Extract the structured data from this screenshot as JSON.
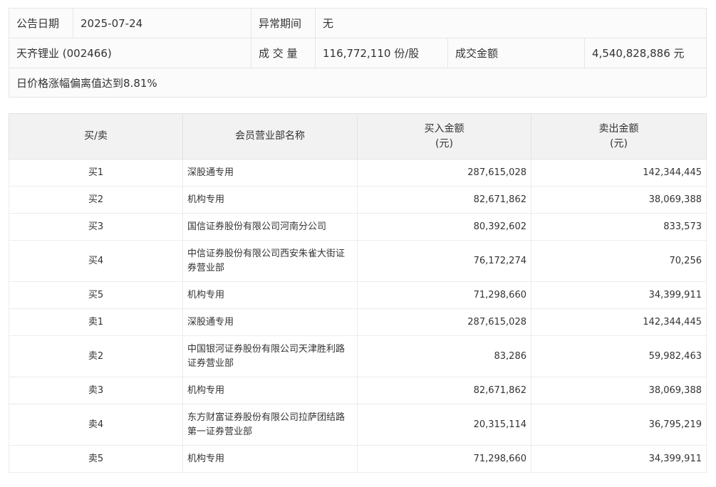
{
  "info": {
    "announce_date_label": "公告日期",
    "announce_date_value": "2025-07-24",
    "abnormal_period_label": "异常期间",
    "abnormal_period_value": "无",
    "stock_name": "天齐锂业 (002466)",
    "volume_label": "成 交 量",
    "volume_value": "116,772,110 份/股",
    "turnover_label": "成交金额",
    "turnover_value": "4,540,828,886 元",
    "reason": "日价格涨幅偏离值达到8.81%"
  },
  "table": {
    "headers": {
      "side": "买/卖",
      "member": "会员营业部名称",
      "buy": "买入金额\n(元)",
      "sell": "卖出金额\n(元)"
    },
    "rows": [
      {
        "side": "买1",
        "member": "深股通专用",
        "buy": "287,615,028",
        "sell": "142,344,445"
      },
      {
        "side": "买2",
        "member": "机构专用",
        "buy": "82,671,862",
        "sell": "38,069,388"
      },
      {
        "side": "买3",
        "member": "国信证券股份有限公司河南分公司",
        "buy": "80,392,602",
        "sell": "833,573"
      },
      {
        "side": "买4",
        "member": "中信证券股份有限公司西安朱雀大街证券营业部",
        "buy": "76,172,274",
        "sell": "70,256"
      },
      {
        "side": "买5",
        "member": "机构专用",
        "buy": "71,298,660",
        "sell": "34,399,911"
      },
      {
        "side": "卖1",
        "member": "深股通专用",
        "buy": "287,615,028",
        "sell": "142,344,445"
      },
      {
        "side": "卖2",
        "member": "中国银河证券股份有限公司天津胜利路证券营业部",
        "buy": "83,286",
        "sell": "59,982,463"
      },
      {
        "side": "卖3",
        "member": "机构专用",
        "buy": "82,671,862",
        "sell": "38,069,388"
      },
      {
        "side": "卖4",
        "member": "东方财富证券股份有限公司拉萨团结路第一证券营业部",
        "buy": "20,315,114",
        "sell": "36,795,219"
      },
      {
        "side": "卖5",
        "member": "机构专用",
        "buy": "71,298,660",
        "sell": "34,399,911"
      }
    ]
  }
}
